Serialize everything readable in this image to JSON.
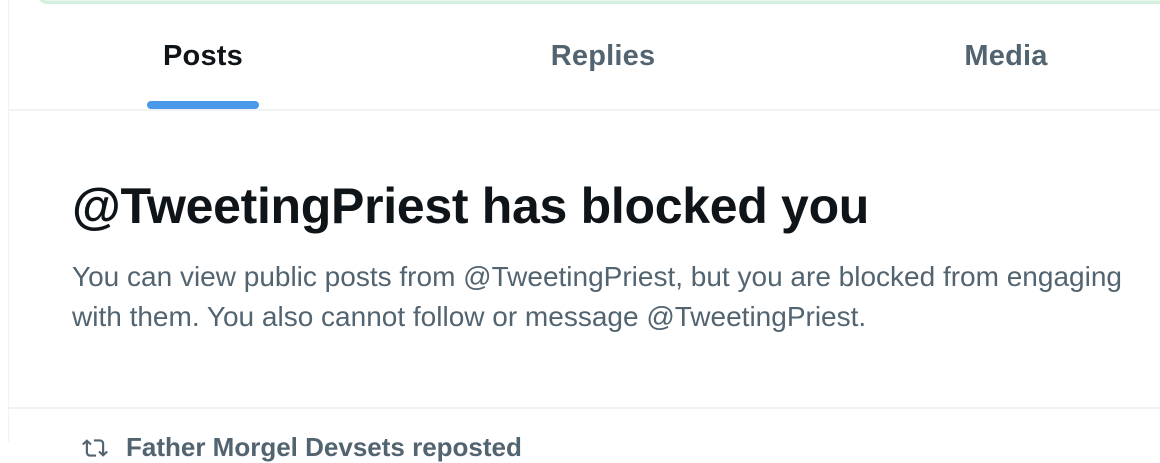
{
  "tabs": [
    {
      "label": "Posts",
      "active": true
    },
    {
      "label": "Replies",
      "active": false
    },
    {
      "label": "Media",
      "active": false
    }
  ],
  "blocked": {
    "title": "@TweetingPriest has blocked you",
    "message": "You can view public posts from @TweetingPriest, but you are blocked from engaging with them. You also cannot follow or message @TweetingPriest."
  },
  "next_item": {
    "icon": "retweet-icon",
    "text": "Father Morgel Devsets reposted"
  },
  "colors": {
    "accent": "#4a99e9",
    "primary_text": "#0f1419",
    "secondary_text": "#536471",
    "divider": "#eff3f4",
    "banner": "#eaf7ef"
  }
}
